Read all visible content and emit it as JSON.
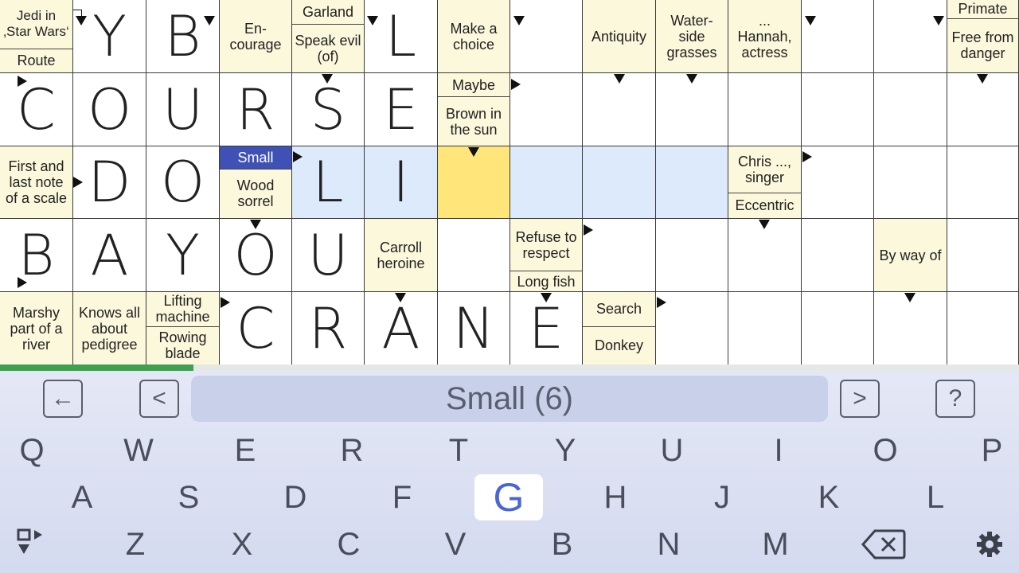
{
  "grid": {
    "row0": {
      "c0_top": "Jedi in ‚Star Wars‘",
      "c0_bot": "Route",
      "c1": "Y",
      "c2": "B",
      "c3": "En-courage",
      "c4_top": "Garland",
      "c4_bot": "Speak evil (of)",
      "c5": "L",
      "c6": "Make a choice",
      "c8": "Antiquity",
      "c9": "Water-side grasses",
      "c10": "... Hannah, actress",
      "c13_top": "Primate",
      "c13_bot": "Free from danger"
    },
    "row1": {
      "c0": "C",
      "c1": "O",
      "c2": "U",
      "c3": "R",
      "c4": "S",
      "c5": "E",
      "c6_top": "Maybe",
      "c6_bot": "Brown in the sun"
    },
    "row2": {
      "c0": "First and last note of a scale",
      "c1": "D",
      "c2": "O",
      "c3_top": "Small",
      "c3_bot": "Wood sorrel",
      "c4": "L",
      "c5": "I",
      "c10_top": "Chris ..., singer",
      "c10_bot": "Eccentric"
    },
    "row3": {
      "c0": "B",
      "c1": "A",
      "c2": "Y",
      "c3": "O",
      "c4": "U",
      "c5": "Carroll heroine",
      "c7_top": "Refuse to respect",
      "c7_bot": "Long fish",
      "c12": "By way of"
    },
    "row4": {
      "c0": "Marshy part of a river",
      "c1": "Knows all about pedigree",
      "c2_top": "Lifting machine",
      "c2_bot": "Rowing blade",
      "c3": "C",
      "c4": "R",
      "c5": "A",
      "c6": "N",
      "c7": "E",
      "c8_top": "Search",
      "c8_bot": "Donkey"
    }
  },
  "progress": {
    "fraction": 0.19
  },
  "toolbar": {
    "back_icon": "arrow-left-icon",
    "prev_icon": "chevron-left-icon",
    "clue": "Small (6)",
    "next_icon": "chevron-right-icon",
    "help_icon": "question-mark-icon",
    "back_glyph": "←",
    "prev_glyph": "<",
    "next_glyph": ">",
    "help_glyph": "?"
  },
  "keyboard": {
    "row1": [
      "Q",
      "W",
      "E",
      "R",
      "T",
      "Y",
      "U",
      "I",
      "O",
      "P"
    ],
    "row2": [
      "A",
      "S",
      "D",
      "F",
      "G",
      "H",
      "J",
      "K",
      "L"
    ],
    "row3": [
      "Z",
      "X",
      "C",
      "V",
      "B",
      "N",
      "M"
    ],
    "active_key": "G",
    "switch_icon": "direction-toggle-icon",
    "backspace_icon": "backspace-icon",
    "settings_icon": "gear-icon"
  },
  "colors": {
    "highlight": "#dceafb",
    "current": "#ffe57a",
    "clue_bg": "#fbf8dc",
    "active_clue": "#3f51b5",
    "progress": "#3da150"
  }
}
